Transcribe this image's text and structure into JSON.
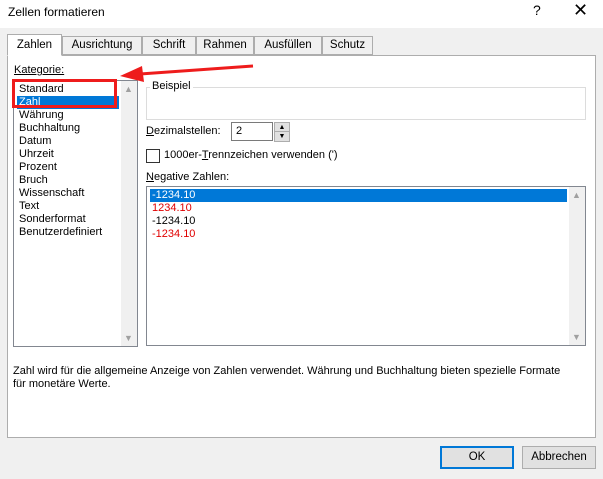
{
  "window": {
    "title": "Zellen formatieren",
    "help": "?",
    "close": "✕"
  },
  "tabs": [
    "Zahlen",
    "Ausrichtung",
    "Schrift",
    "Rahmen",
    "Ausfüllen",
    "Schutz"
  ],
  "category": {
    "label": "Kategorie:",
    "items": [
      "Standard",
      "Zahl",
      "Währung",
      "Buchhaltung",
      "Datum",
      "Uhrzeit",
      "Prozent",
      "Bruch",
      "Wissenschaft",
      "Text",
      "Sonderformat",
      "Benutzerdefiniert"
    ],
    "selected": "Zahl"
  },
  "sample": {
    "label": "Beispiel"
  },
  "decimals": {
    "label": "Dezimalstellen:",
    "value": "2"
  },
  "thousands": {
    "label": "1000er-Trennzeichen verwenden (')",
    "checked": false
  },
  "negative": {
    "label": "Negative Zahlen:",
    "items": [
      {
        "text": "-1234.10",
        "color": "#000000"
      },
      {
        "text": "1234.10",
        "color": "#e00000"
      },
      {
        "text": "-1234.10",
        "color": "#000000"
      },
      {
        "text": "-1234.10",
        "color": "#e00000"
      }
    ]
  },
  "description": "Zahl wird für die allgemeine Anzeige von Zahlen verwendet. Währung und Buchhaltung bieten spezielle Formate für monetäre Werte.",
  "buttons": {
    "ok": "OK",
    "cancel": "Abbrechen"
  },
  "annotation_color": "#ee1c1c",
  "icons": {
    "close": "close-icon",
    "help": "help-icon",
    "scroll_up": "scroll-up-icon",
    "scroll_down": "scroll-down-icon"
  }
}
